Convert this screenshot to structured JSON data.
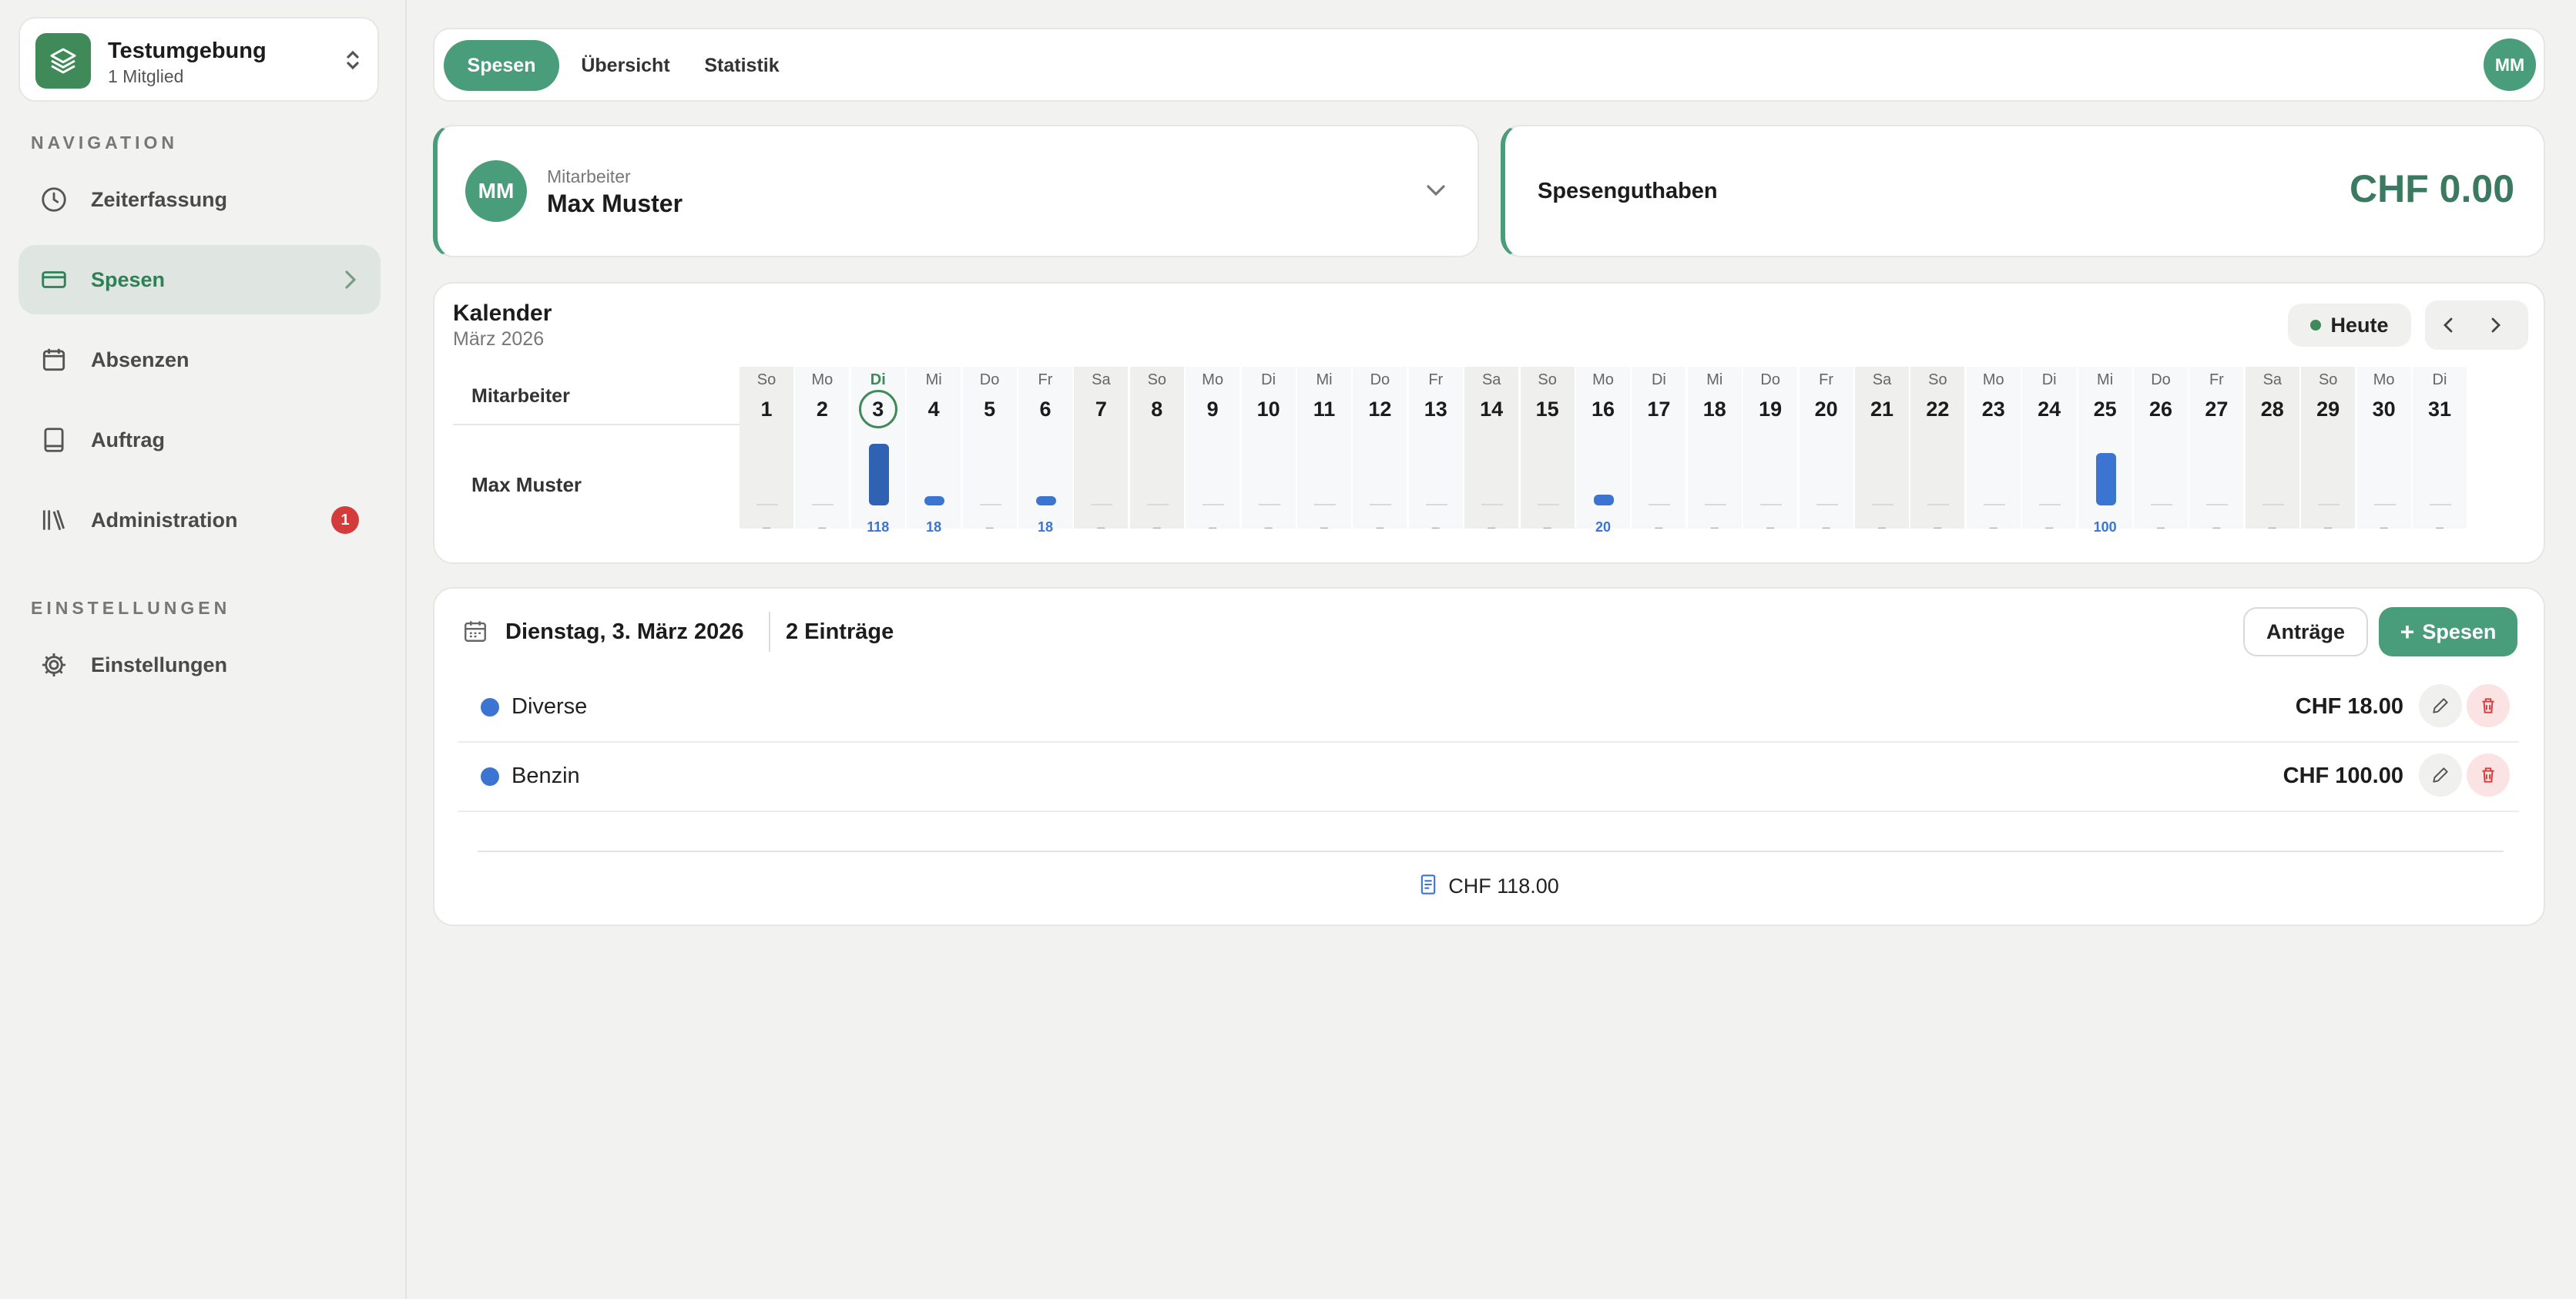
{
  "workspace": {
    "name": "Testumgebung",
    "members": "1 Mitglied"
  },
  "sidebar": {
    "nav_heading": "NAVIGATION",
    "items": [
      {
        "label": "Zeiterfassung",
        "icon": "clock-icon"
      },
      {
        "label": "Spesen",
        "icon": "credit-card-icon",
        "active": true
      },
      {
        "label": "Absenzen",
        "icon": "calendar-icon"
      },
      {
        "label": "Auftrag",
        "icon": "book-icon"
      },
      {
        "label": "Administration",
        "icon": "library-icon",
        "badge": "1"
      }
    ],
    "settings_heading": "EINSTELLUNGEN",
    "settings_item": {
      "label": "Einstellungen",
      "icon": "gear-icon"
    }
  },
  "tabs": [
    {
      "label": "Spesen",
      "active": true
    },
    {
      "label": "Übersicht"
    },
    {
      "label": "Statistik"
    }
  ],
  "user": {
    "initials": "MM"
  },
  "employee": {
    "caption": "Mitarbeiter",
    "name": "Max Muster",
    "initials": "MM"
  },
  "balance": {
    "label": "Spesenguthaben",
    "amount": "CHF 0.00"
  },
  "calendar": {
    "title": "Kalender",
    "month": "März 2026",
    "today_button": "Heute",
    "column_header": "Mitarbeiter",
    "row_name": "Max Muster",
    "days": [
      {
        "wd": "So",
        "d": "1",
        "v": "–",
        "weekend": true
      },
      {
        "wd": "Mo",
        "d": "2",
        "v": "–"
      },
      {
        "wd": "Di",
        "d": "3",
        "v": "118",
        "amount": 118,
        "today": true
      },
      {
        "wd": "Mi",
        "d": "4",
        "v": "18",
        "amount": 18
      },
      {
        "wd": "Do",
        "d": "5",
        "v": "–"
      },
      {
        "wd": "Fr",
        "d": "6",
        "v": "18",
        "amount": 18
      },
      {
        "wd": "Sa",
        "d": "7",
        "v": "–",
        "weekend": true
      },
      {
        "wd": "So",
        "d": "8",
        "v": "–",
        "weekend": true
      },
      {
        "wd": "Mo",
        "d": "9",
        "v": "–"
      },
      {
        "wd": "Di",
        "d": "10",
        "v": "–"
      },
      {
        "wd": "Mi",
        "d": "11",
        "v": "–"
      },
      {
        "wd": "Do",
        "d": "12",
        "v": "–"
      },
      {
        "wd": "Fr",
        "d": "13",
        "v": "–"
      },
      {
        "wd": "Sa",
        "d": "14",
        "v": "–",
        "weekend": true
      },
      {
        "wd": "So",
        "d": "15",
        "v": "–",
        "weekend": true
      },
      {
        "wd": "Mo",
        "d": "16",
        "v": "20",
        "amount": 20
      },
      {
        "wd": "Di",
        "d": "17",
        "v": "–"
      },
      {
        "wd": "Mi",
        "d": "18",
        "v": "–"
      },
      {
        "wd": "Do",
        "d": "19",
        "v": "–"
      },
      {
        "wd": "Fr",
        "d": "20",
        "v": "–"
      },
      {
        "wd": "Sa",
        "d": "21",
        "v": "–",
        "weekend": true
      },
      {
        "wd": "So",
        "d": "22",
        "v": "–",
        "weekend": true
      },
      {
        "wd": "Mo",
        "d": "23",
        "v": "–"
      },
      {
        "wd": "Di",
        "d": "24",
        "v": "–"
      },
      {
        "wd": "Mi",
        "d": "25",
        "v": "100",
        "amount": 100
      },
      {
        "wd": "Do",
        "d": "26",
        "v": "–"
      },
      {
        "wd": "Fr",
        "d": "27",
        "v": "–"
      },
      {
        "wd": "Sa",
        "d": "28",
        "v": "–",
        "weekend": true
      },
      {
        "wd": "So",
        "d": "29",
        "v": "–",
        "weekend": true
      },
      {
        "wd": "Mo",
        "d": "30",
        "v": "–"
      },
      {
        "wd": "Di",
        "d": "31",
        "v": "–"
      }
    ]
  },
  "day_detail": {
    "date": "Dienstag, 3. März 2026",
    "count": "2 Einträge",
    "requests_button": "Anträge",
    "add_button": "Spesen",
    "entries": [
      {
        "name": "Diverse",
        "amount": "CHF 18.00"
      },
      {
        "name": "Benzin",
        "amount": "CHF 100.00"
      }
    ],
    "total": "CHF 118.00"
  },
  "colors": {
    "accent": "#4a9d7a",
    "brand": "#3f8a58",
    "bar": "#3b74d1",
    "danger": "#d43b3b"
  }
}
